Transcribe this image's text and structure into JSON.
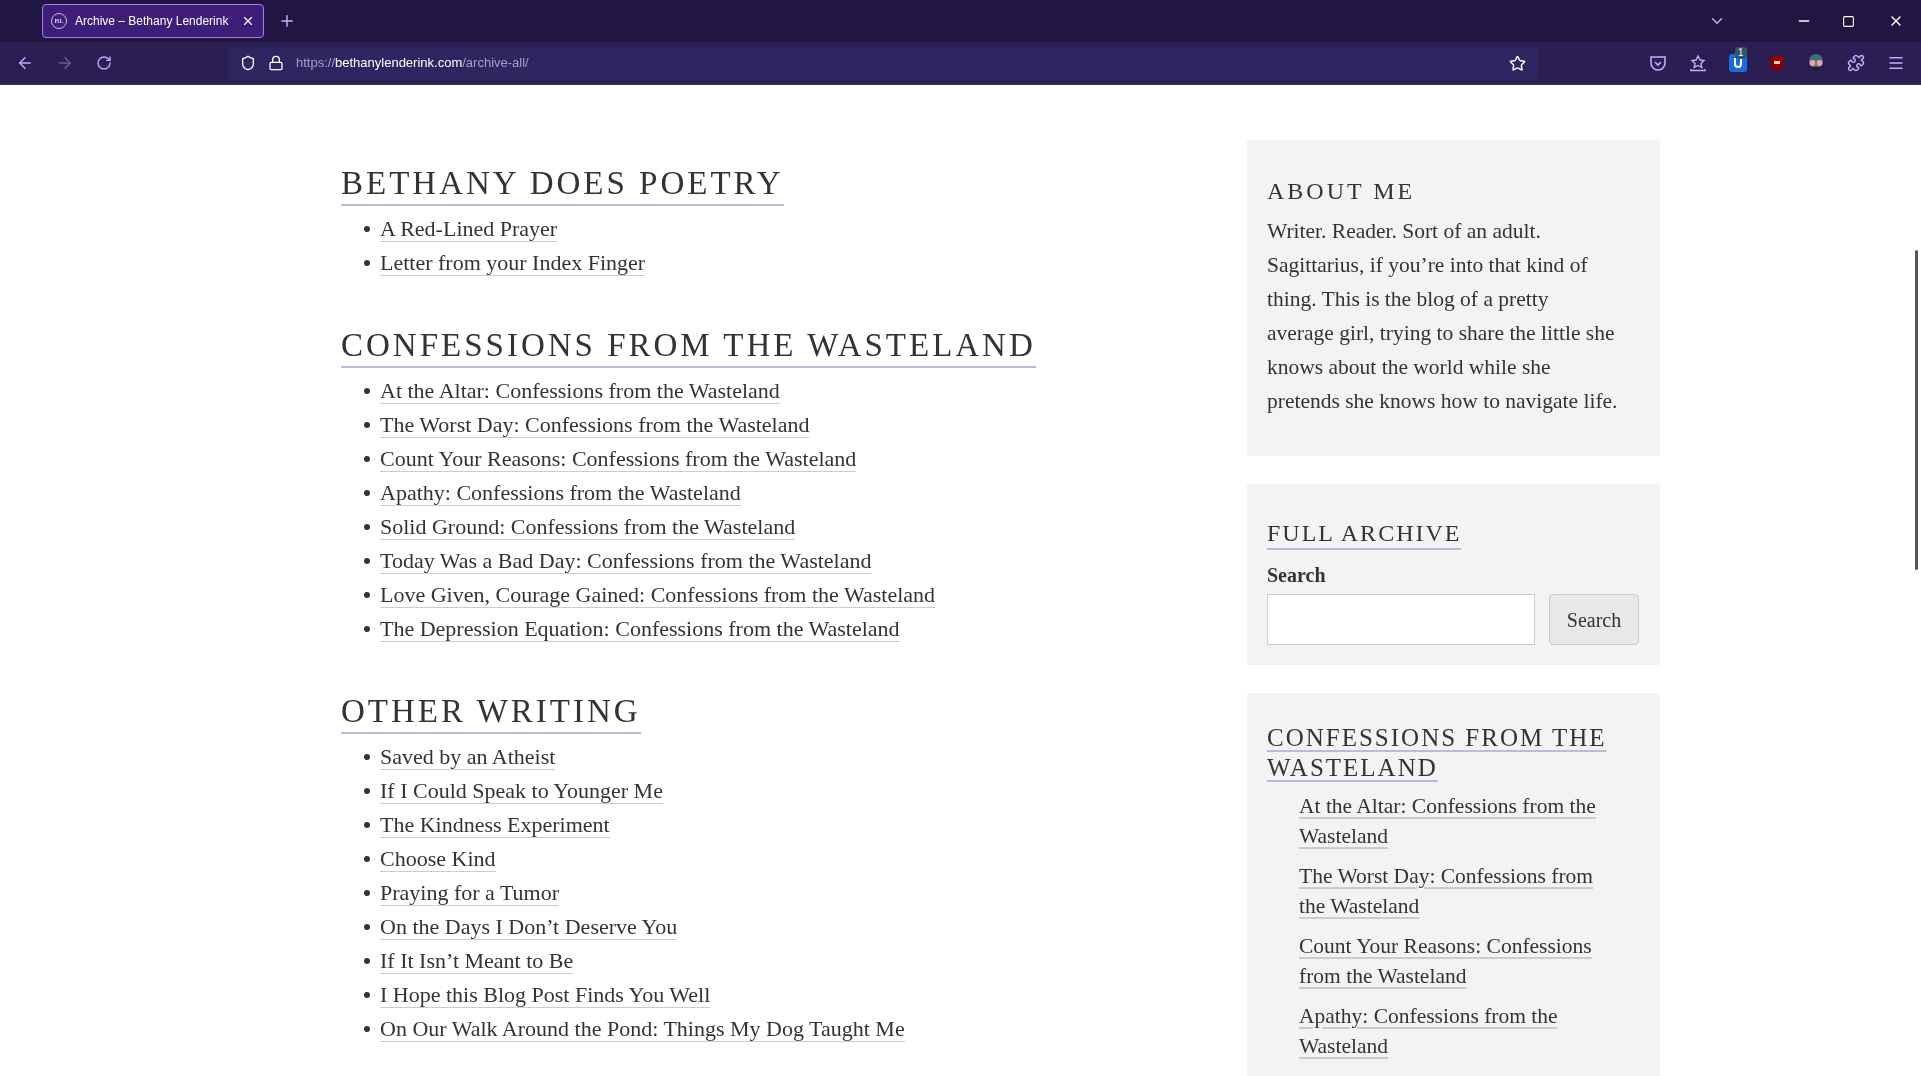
{
  "browser": {
    "tabs": [
      {
        "title": "Archive – Bethany Lenderink",
        "favicon": "BL",
        "selected": true
      }
    ],
    "url": {
      "scheme": "https://",
      "domain": "bethanylenderink.com",
      "path": "/archive-all/"
    },
    "extension_badge": "1"
  },
  "sections": [
    {
      "title": "BETHANY DOES POETRY",
      "items": [
        "A Red-Lined Prayer",
        "Letter from your Index Finger"
      ]
    },
    {
      "title": "CONFESSIONS FROM THE WASTELAND",
      "items": [
        "At the Altar: Confessions from the Wasteland",
        "The Worst Day: Confessions from the Wasteland",
        "Count Your Reasons: Confessions from the Wasteland",
        "Apathy: Confessions from the Wasteland",
        "Solid Ground: Confessions from the Wasteland",
        "Today Was a Bad Day: Confessions from the Wasteland",
        "Love Given, Courage Gained: Confessions from the Wasteland",
        "The Depression Equation: Confessions from the Wasteland"
      ]
    },
    {
      "title": "OTHER WRITING",
      "items": [
        "Saved by an Atheist",
        "If I Could Speak to Younger Me",
        "The Kindness Experiment",
        "Choose Kind",
        "Praying for a Tumor",
        "On the Days I Don’t Deserve You",
        "If It Isn’t Meant to Be",
        "I Hope this Blog Post Finds You Well",
        "On Our Walk Around the Pond: Things My Dog Taught Me"
      ]
    }
  ],
  "sidebar": {
    "about": {
      "title": "ABOUT ME",
      "text": "Writer. Reader. Sort of an adult. Sagittarius, if you’re into that kind of thing. This is the blog of a pretty average girl, trying to share the little she knows about the world while she pretends she knows how to navigate life."
    },
    "archive": {
      "title": "FULL ARCHIVE",
      "search_label": "Search",
      "search_button": "Search"
    },
    "series": {
      "title": "CONFESSIONS FROM THE WASTELAND",
      "items": [
        "At the Altar: Confessions from the Wasteland",
        "The Worst Day: Confessions from the Wasteland",
        "Count Your Reasons: Confessions from the Wasteland",
        "Apathy: Confessions from the Wasteland"
      ]
    }
  }
}
